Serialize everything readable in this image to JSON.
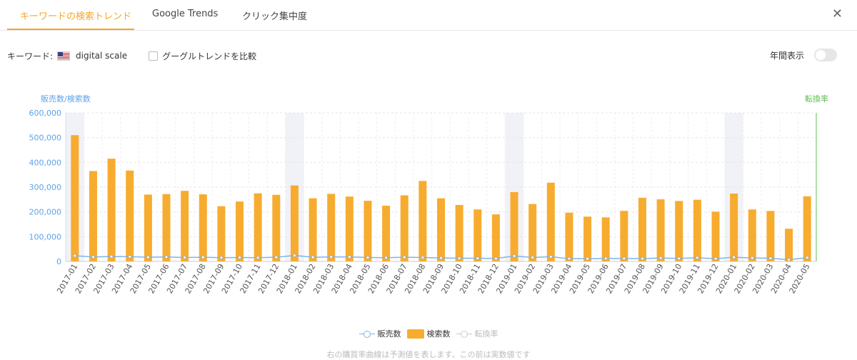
{
  "tabs": [
    {
      "label": "キーワードの検索トレンド",
      "active": true
    },
    {
      "label": "Google Trends",
      "active": false
    },
    {
      "label": "クリック集中度",
      "active": false
    }
  ],
  "close_icon": "✕",
  "toolbar": {
    "keyword_label": "キーワード:",
    "flag": "us-flag-icon",
    "keyword_value": "digital scale",
    "compare_label": "グーグルトレンドを比較",
    "compare_checked": false,
    "annual_label": "年間表示",
    "annual_on": false
  },
  "legend": {
    "sales": "販売数",
    "search": "検索数",
    "conversion": "転換率"
  },
  "footnote": "右の購買率曲線は予測値を表します、この前は実数値です",
  "colors": {
    "accent": "#f5a623",
    "bar": "#f7ac2f",
    "sales_line": "#7db4ea",
    "left_axis": "#5ba3ea",
    "right_axis": "#5cbf4d",
    "highlight": "#f1f2f7"
  },
  "chart_data": {
    "type": "bar",
    "left_axis_title": "販売数/検索数",
    "right_axis_title": "転換率",
    "ylim": [
      0,
      600000
    ],
    "yticks": [
      "0",
      "100,000",
      "200,000",
      "300,000",
      "400,000",
      "500,000",
      "600,000"
    ],
    "categories": [
      "2017-01",
      "2017-02",
      "2017-03",
      "2017-04",
      "2017-05",
      "2017-06",
      "2017-07",
      "2017-08",
      "2017-09",
      "2017-10",
      "2017-11",
      "2017-12",
      "2018-01",
      "2018-02",
      "2018-03",
      "2018-04",
      "2018-05",
      "2018-06",
      "2018-07",
      "2018-08",
      "2018-09",
      "2018-10",
      "2018-11",
      "2018-12",
      "2019-01",
      "2019-02",
      "2019-03",
      "2019-04",
      "2019-05",
      "2019-06",
      "2019-07",
      "2019-08",
      "2019-09",
      "2019-10",
      "2019-11",
      "2019-12",
      "2020-01",
      "2020-02",
      "2020-03",
      "2020-04",
      "2020-05"
    ],
    "highlighted_categories": [
      "2017-01",
      "2018-01",
      "2019-01",
      "2020-01"
    ],
    "series": [
      {
        "name": "検索数",
        "kind": "bar",
        "values": [
          510000,
          365000,
          415000,
          367000,
          270000,
          272000,
          285000,
          271000,
          223000,
          242000,
          275000,
          269000,
          307000,
          255000,
          273000,
          262000,
          245000,
          225000,
          267000,
          325000,
          255000,
          228000,
          210000,
          190000,
          280000,
          232000,
          318000,
          197000,
          181000,
          178000,
          204000,
          257000,
          251000,
          244000,
          249000,
          201000,
          274000,
          210000,
          204000,
          132000,
          263000
        ]
      },
      {
        "name": "販売数",
        "kind": "line",
        "values": [
          23000,
          18000,
          20000,
          19000,
          17000,
          18000,
          16000,
          17000,
          15000,
          16000,
          15000,
          17000,
          24000,
          17000,
          18000,
          18000,
          16000,
          15000,
          17000,
          16000,
          14000,
          13000,
          13000,
          12000,
          22000,
          16000,
          19000,
          11000,
          11000,
          12000,
          12000,
          11000,
          14000,
          12000,
          15000,
          11000,
          17000,
          14000,
          13000,
          7000,
          15000
        ]
      }
    ]
  }
}
